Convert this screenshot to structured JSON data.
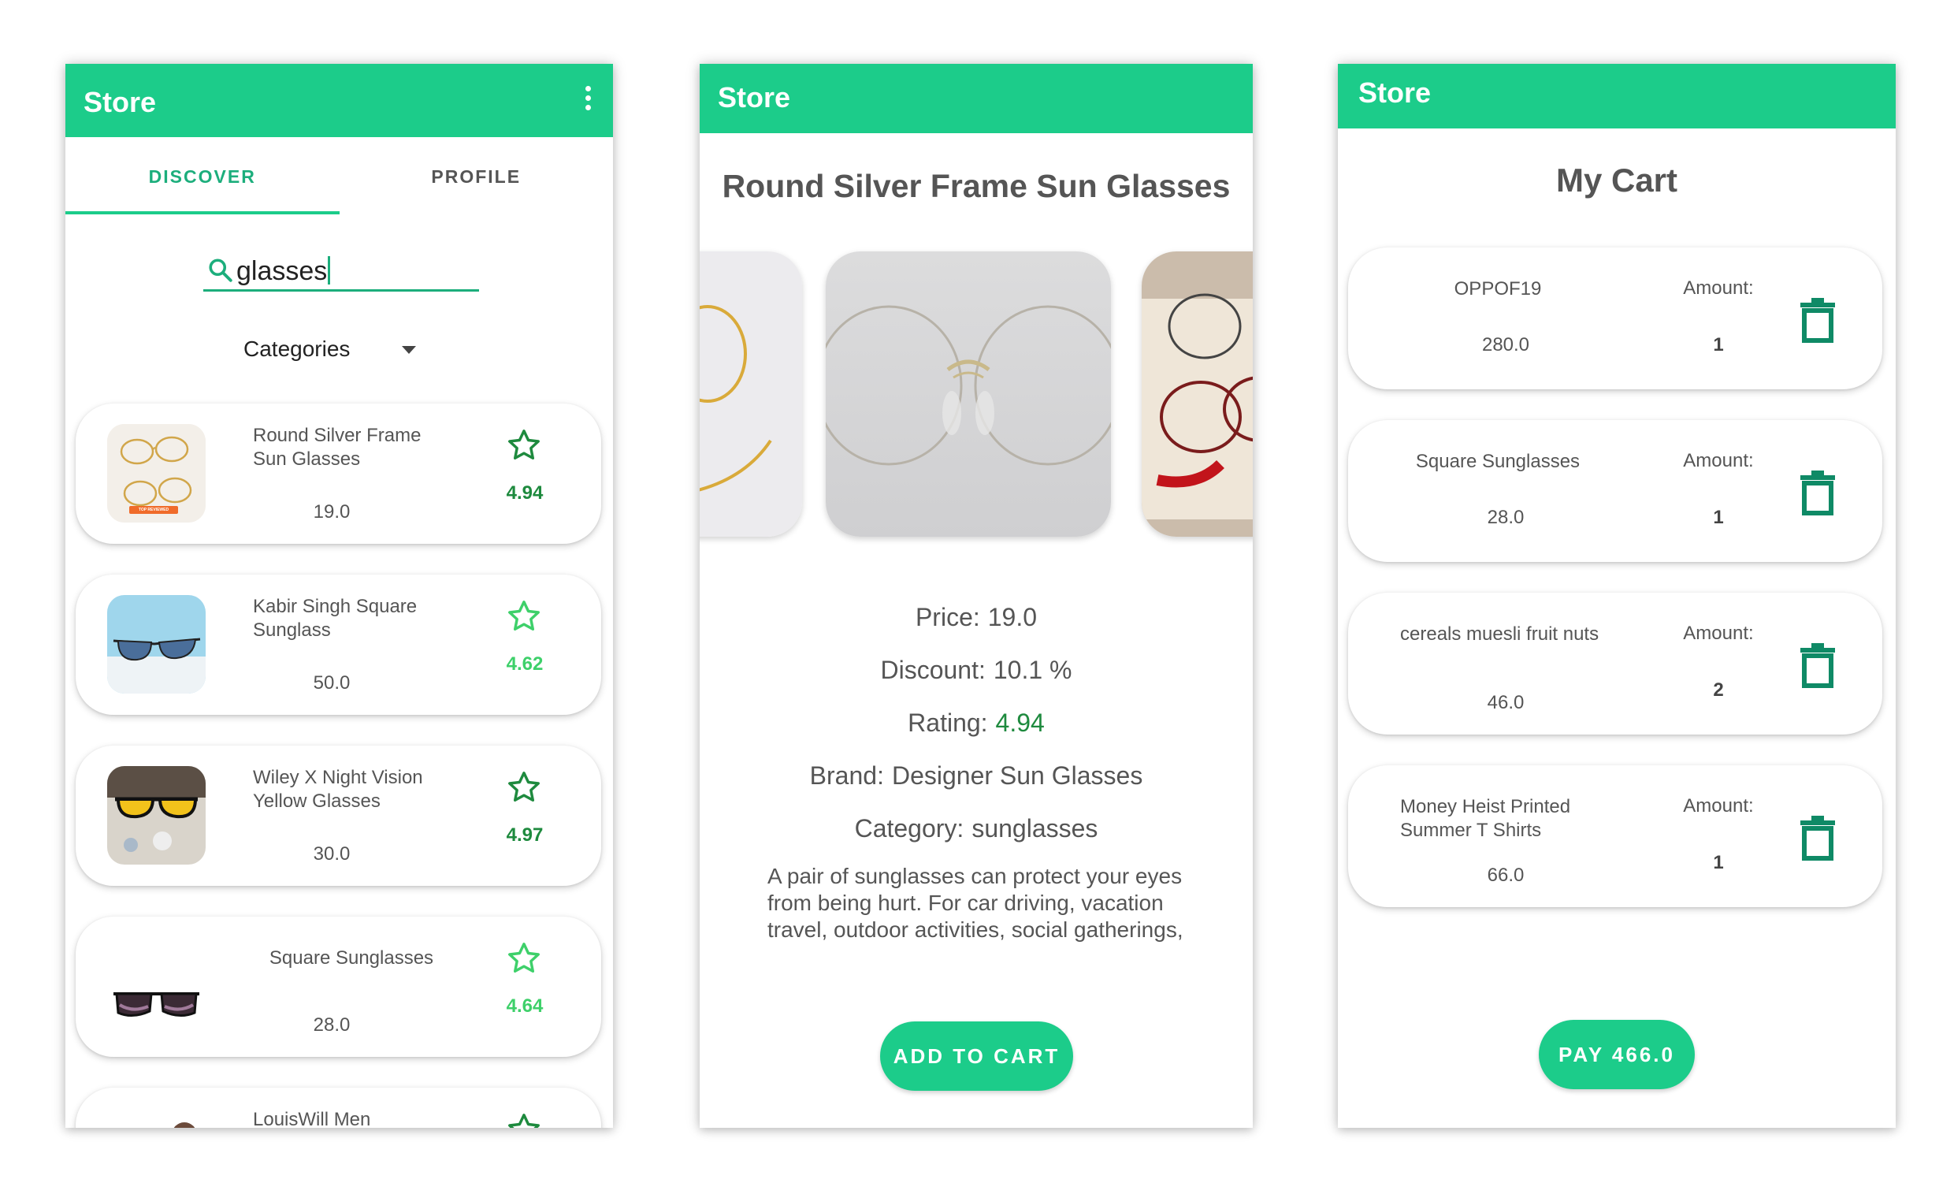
{
  "colors": {
    "primary": "#1ccc8a",
    "rating_dark": "#1e8a3e",
    "rating_light": "#3ed06a",
    "text": "#555555"
  },
  "discover_screen": {
    "app_title": "Store",
    "menu_icon": "more-vert-icon",
    "tabs": [
      {
        "label": "DISCOVER",
        "active": true
      },
      {
        "label": "PROFILE",
        "active": false
      }
    ],
    "search": {
      "icon": "search-icon",
      "value": "glasses"
    },
    "category_dropdown": {
      "label": "Categories",
      "icon": "arrow-drop-down-icon"
    },
    "products": [
      {
        "name": "Round Silver Frame Sun Glasses",
        "price": "19.0",
        "rating": "4.94",
        "icon": "star-outline-icon"
      },
      {
        "name": "Kabir Singh Square Sunglass",
        "price": "50.0",
        "rating": "4.62",
        "icon": "star-outline-icon"
      },
      {
        "name": "Wiley X Night Vision Yellow Glasses",
        "price": "30.0",
        "rating": "4.97",
        "icon": "star-outline-icon"
      },
      {
        "name": "Square Sunglasses",
        "price": "28.0",
        "rating": "4.64",
        "icon": "star-outline-icon"
      },
      {
        "name": "LouisWill Men",
        "price": "",
        "rating": "",
        "icon": "star-outline-icon"
      }
    ],
    "thumb_badge_text": "TOP REVIEWED"
  },
  "detail_screen": {
    "app_title": "Store",
    "product_title": "Round Silver Frame Sun Glasses",
    "carousel_images": [
      "gold-frame-glasses-photo",
      "round-silver-frame-photo",
      "assorted-glasses-tray-photo"
    ],
    "fields": [
      {
        "label": "Price:",
        "value": "19.0"
      },
      {
        "label": "Discount:",
        "value": "10.1 %"
      },
      {
        "label": "Rating:",
        "value": "4.94"
      },
      {
        "label": "Brand:",
        "value": "Designer Sun Glasses"
      },
      {
        "label": "Category:",
        "value": "sunglasses"
      }
    ],
    "description": "A pair of sunglasses can protect your eyes from being hurt. For car driving, vacation travel, outdoor activities, social gatherings,",
    "add_to_cart_label": "ADD TO CART"
  },
  "cart_screen": {
    "app_title": "Store",
    "title": "My Cart",
    "amount_label": "Amount:",
    "items": [
      {
        "name": "OPPOF19",
        "price": "280.0",
        "amount": "1",
        "icon": "delete-icon"
      },
      {
        "name": "Square Sunglasses",
        "price": "28.0",
        "amount": "1",
        "icon": "delete-icon"
      },
      {
        "name": "cereals muesli fruit nuts",
        "price": "46.0",
        "amount": "2",
        "icon": "delete-icon"
      },
      {
        "name": "Money Heist Printed Summer T Shirts",
        "price": "66.0",
        "amount": "1",
        "icon": "delete-icon"
      }
    ],
    "pay_label": "PAY 466.0"
  }
}
